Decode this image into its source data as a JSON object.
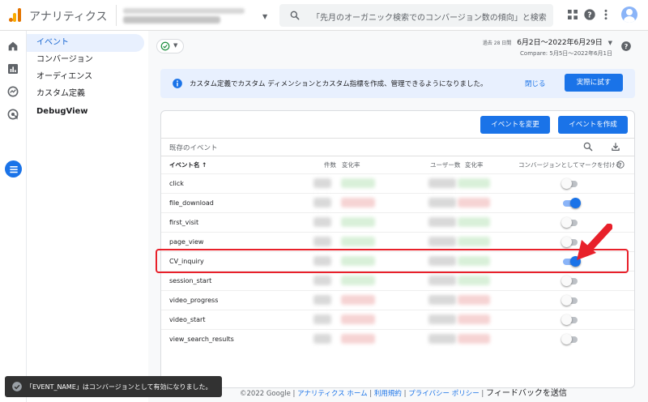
{
  "app": {
    "title": "アナリティクス"
  },
  "search": {
    "placeholder": "「先月のオーガニック検索でのコンバージョン数の傾向」と検索し..."
  },
  "topbar_icons": [
    "apps-icon",
    "help-icon",
    "more-vert-icon",
    "account-avatar"
  ],
  "left_rail": [
    "home-icon",
    "reports-icon",
    "explore-icon",
    "advertising-icon",
    "configure-icon"
  ],
  "subnav": {
    "items": [
      {
        "label": "イベント",
        "active": true
      },
      {
        "label": "コンバージョン"
      },
      {
        "label": "オーディエンス"
      },
      {
        "label": "カスタム定義"
      },
      {
        "label": "DebugView"
      }
    ]
  },
  "date_range": {
    "prefix": "過去 28 日間",
    "range": "6月2日～2022年6月29日",
    "compare": "Compare: 5月5日～2022年6月1日"
  },
  "banner": {
    "text": "カスタム定義でカスタム ディメンションとカスタム指標を作成、管理できるようになりました。",
    "close_label": "閉じる",
    "try_label": "実際に試す"
  },
  "card": {
    "modify_button": "イベントを変更",
    "create_button": "イベントを作成",
    "title": "既存のイベント",
    "columns": {
      "name": "イベント名 ↑",
      "count": "件数",
      "count_change": "変化率",
      "users": "ユーザー数",
      "users_change": "変化率",
      "conversion": "コンバージョンとしてマークを付ける"
    },
    "rows": [
      {
        "name": "click",
        "conversion": false
      },
      {
        "name": "file_download",
        "conversion": true
      },
      {
        "name": "first_visit",
        "conversion": false
      },
      {
        "name": "page_view",
        "conversion": false
      },
      {
        "name": "CV_inquiry",
        "conversion": true
      },
      {
        "name": "session_start",
        "conversion": false
      },
      {
        "name": "video_progress",
        "conversion": false
      },
      {
        "name": "video_start",
        "conversion": false
      },
      {
        "name": "view_search_results",
        "conversion": false
      }
    ]
  },
  "footer": {
    "copyright": "©2022 Google",
    "sep": " | ",
    "home": "アナリティクス ホーム",
    "terms": "利用規約",
    "privacy": "プライバシー ポリシー",
    "feedback": "フィードバックを送信"
  },
  "toast": {
    "text": "「EVENT_NAME」はコンバージョンとして有効になりました。"
  },
  "colors": {
    "accent": "#1a73e8",
    "highlight": "#e8202a",
    "toast_bg": "#323232",
    "brand": "#e37400"
  }
}
